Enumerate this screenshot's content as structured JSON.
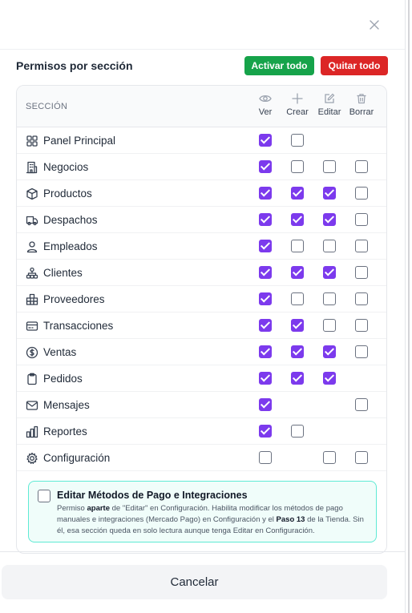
{
  "header": {
    "title": "Permisos por sección",
    "activate_all": "Activar todo",
    "remove_all": "Quitar todo"
  },
  "table": {
    "section_header": "SECCIÓN",
    "columns": [
      {
        "label": "Ver",
        "icon": "eye-icon"
      },
      {
        "label": "Crear",
        "icon": "plus-icon"
      },
      {
        "label": "Editar",
        "icon": "edit-icon"
      },
      {
        "label": "Borrar",
        "icon": "trash-icon"
      }
    ],
    "rows": [
      {
        "label": "Panel Principal",
        "icon": "grid-icon",
        "perms": [
          true,
          false,
          null,
          null
        ]
      },
      {
        "label": "Negocios",
        "icon": "building-icon",
        "perms": [
          true,
          false,
          false,
          false
        ]
      },
      {
        "label": "Productos",
        "icon": "box-icon",
        "perms": [
          true,
          true,
          true,
          false
        ]
      },
      {
        "label": "Despachos",
        "icon": "truck-icon",
        "perms": [
          true,
          true,
          true,
          false
        ]
      },
      {
        "label": "Empleados",
        "icon": "user-icon",
        "perms": [
          true,
          false,
          false,
          false
        ]
      },
      {
        "label": "Clientes",
        "icon": "network-icon",
        "perms": [
          true,
          true,
          true,
          false
        ]
      },
      {
        "label": "Proveedores",
        "icon": "boxes-icon",
        "perms": [
          true,
          false,
          false,
          false
        ]
      },
      {
        "label": "Transacciones",
        "icon": "card-icon",
        "perms": [
          true,
          true,
          false,
          false
        ]
      },
      {
        "label": "Ventas",
        "icon": "dollar-circle-icon",
        "perms": [
          true,
          true,
          true,
          false
        ]
      },
      {
        "label": "Pedidos",
        "icon": "clipboard-icon",
        "perms": [
          true,
          true,
          true,
          null
        ]
      },
      {
        "label": "Mensajes",
        "icon": "mail-icon",
        "perms": [
          true,
          null,
          null,
          false
        ]
      },
      {
        "label": "Reportes",
        "icon": "bar-chart-icon",
        "perms": [
          true,
          false,
          null,
          null
        ]
      },
      {
        "label": "Configuración",
        "icon": "gear-icon",
        "perms": [
          false,
          null,
          false,
          false
        ]
      }
    ]
  },
  "extra": {
    "title": "Editar Métodos de Pago e Integraciones",
    "checked": false,
    "desc_1": "Permiso ",
    "desc_2": "aparte",
    "desc_3": " de \"Editar\" en Configuración. Habilita modificar los métodos de pago manuales e integraciones (Mercado Pago) en Configuración y el ",
    "desc_4": "Paso 13",
    "desc_5": " de la Tienda. Sin él, esa sección queda en solo lectura aunque tenga Editar en Configuración."
  },
  "footer": {
    "cancel_label": "Cancelar"
  },
  "colors": {
    "checked": "#7c3aed",
    "activate": "#16a34a",
    "remove": "#dc2626",
    "extra_border": "#5eead4"
  }
}
